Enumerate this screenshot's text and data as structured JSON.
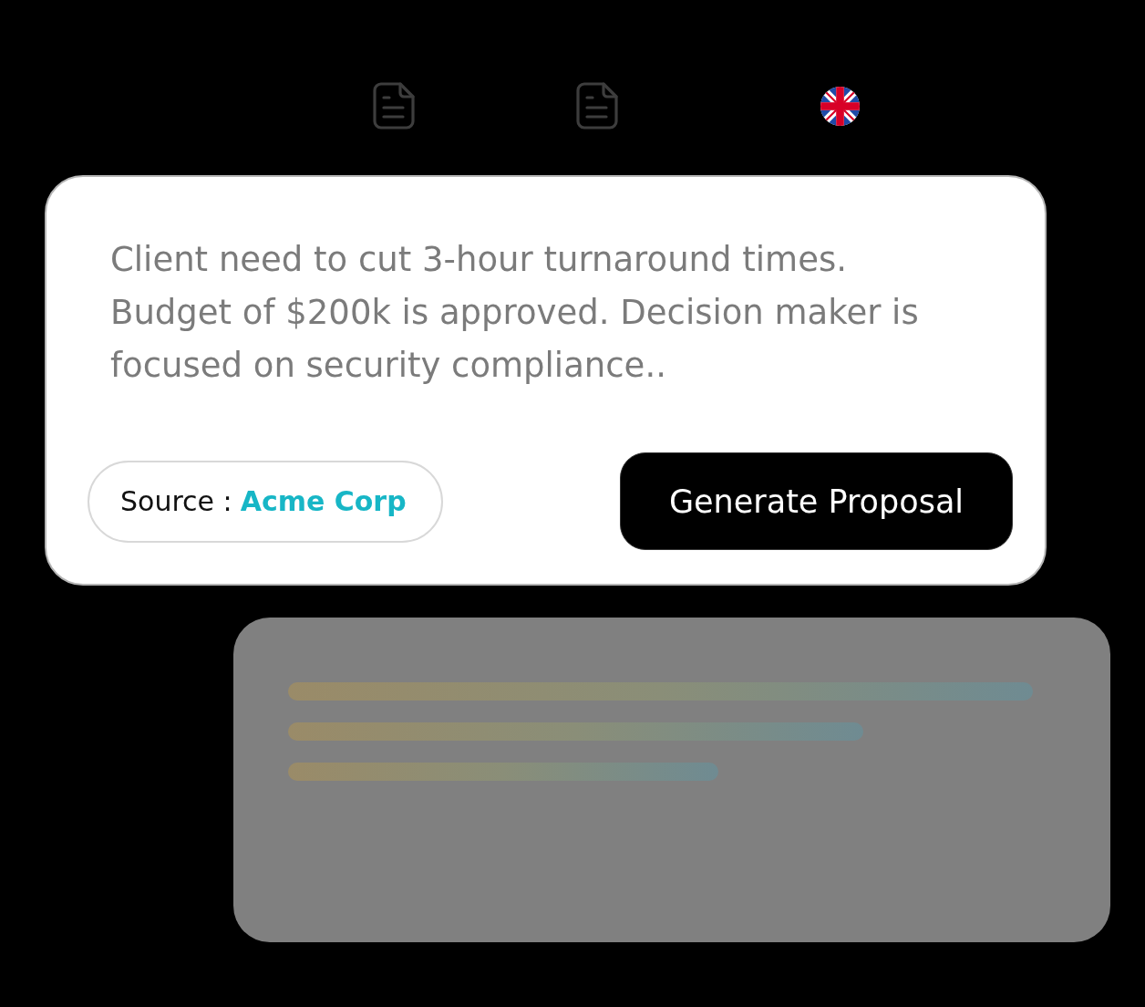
{
  "input_card": {
    "text": "Client need to cut 3-hour turnaround times. Budget of $200k is approved. Decision maker is focused on security compliance..",
    "source": {
      "label": "Source :",
      "value": "Acme Corp"
    },
    "button": "Generate Proposal"
  },
  "output_card": {
    "loading": true
  }
}
